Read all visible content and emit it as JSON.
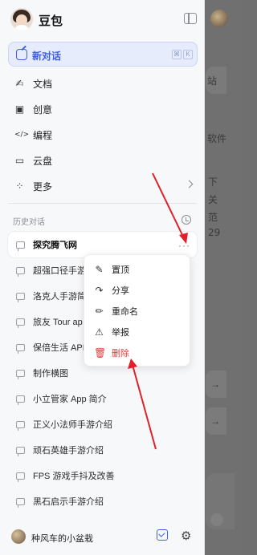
{
  "app": {
    "brand": "豆包"
  },
  "new_chat": {
    "label": "新对话",
    "shortcut_keys": [
      "⌘",
      "K"
    ]
  },
  "nav": [
    {
      "label": "文档",
      "icon": "doc-icon",
      "glyph": "✍"
    },
    {
      "label": "创意",
      "icon": "image-icon",
      "glyph": "▣"
    },
    {
      "label": "编程",
      "icon": "code-icon",
      "glyph": "</>"
    },
    {
      "label": "云盘",
      "icon": "folder-icon",
      "glyph": "▭"
    },
    {
      "label": "更多",
      "icon": "apps-icon",
      "glyph": "⁘"
    }
  ],
  "history": {
    "heading": "历史对话",
    "items": [
      "探究腾飞网",
      "超强口径手游",
      "洛克人手游简",
      "旅友 Tour ap",
      "保倍生活 APP",
      "制作横图",
      "小立管家 App 简介",
      "正义小法师手游介绍",
      "顽石英雄手游介绍",
      "FPS 游戏手抖及改善",
      "黑石启示手游介绍"
    ],
    "more_label": "···"
  },
  "context_menu": [
    {
      "label": "置顶",
      "icon": "pin-icon",
      "glyph": "✎"
    },
    {
      "label": "分享",
      "icon": "share-icon",
      "glyph": "↷"
    },
    {
      "label": "重命名",
      "icon": "edit-icon",
      "glyph": "✏"
    },
    {
      "label": "举报",
      "icon": "warning-icon",
      "glyph": "⚠"
    },
    {
      "label": "删除",
      "icon": "trash-icon",
      "glyph": "🗑"
    }
  ],
  "footer": {
    "user_name": "种风车的小盆栽",
    "gear_glyph": "⚙"
  },
  "background": {
    "fragments": [
      "站",
      "软件",
      "下",
      "关",
      "范",
      "29"
    ],
    "arrow_glyph": "→"
  },
  "colors": {
    "accent": "#3f5ee8",
    "danger": "#e23b3b",
    "annotation_arrow": "#e0202a"
  }
}
